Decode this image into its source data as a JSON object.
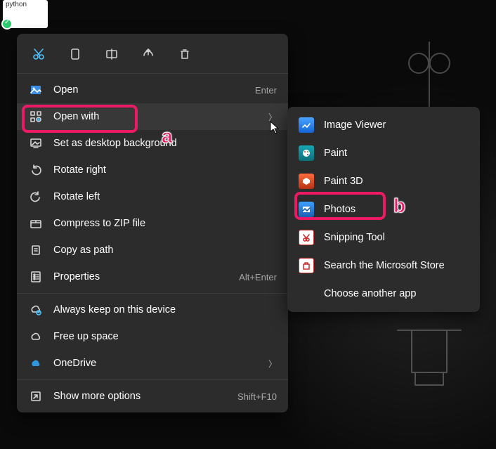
{
  "file_thumb": {
    "label": "python"
  },
  "toolbar": {
    "cut": "cut-icon",
    "copy": "copy-icon",
    "rename": "rename-icon",
    "share": "share-icon",
    "delete": "delete-icon"
  },
  "menu": {
    "open": {
      "label": "Open",
      "shortcut": "Enter"
    },
    "open_with": {
      "label": "Open with",
      "has_submenu": true
    },
    "set_bg": {
      "label": "Set as desktop background"
    },
    "rotate_right": {
      "label": "Rotate right"
    },
    "rotate_left": {
      "label": "Rotate left"
    },
    "compress": {
      "label": "Compress to ZIP file"
    },
    "copy_path": {
      "label": "Copy as path"
    },
    "properties": {
      "label": "Properties",
      "shortcut": "Alt+Enter"
    },
    "always_keep": {
      "label": "Always keep on this device"
    },
    "free_up": {
      "label": "Free up space"
    },
    "onedrive": {
      "label": "OneDrive",
      "has_submenu": true
    },
    "more_options": {
      "label": "Show more options",
      "shortcut": "Shift+F10"
    }
  },
  "submenu": {
    "image_viewer": {
      "label": "Image Viewer"
    },
    "paint": {
      "label": "Paint"
    },
    "paint3d": {
      "label": "Paint 3D"
    },
    "photos": {
      "label": "Photos"
    },
    "snipping": {
      "label": "Snipping Tool"
    },
    "store": {
      "label": "Search the Microsoft Store"
    },
    "choose": {
      "label": "Choose another app"
    }
  },
  "annotations": {
    "a": "a",
    "b": "b"
  }
}
